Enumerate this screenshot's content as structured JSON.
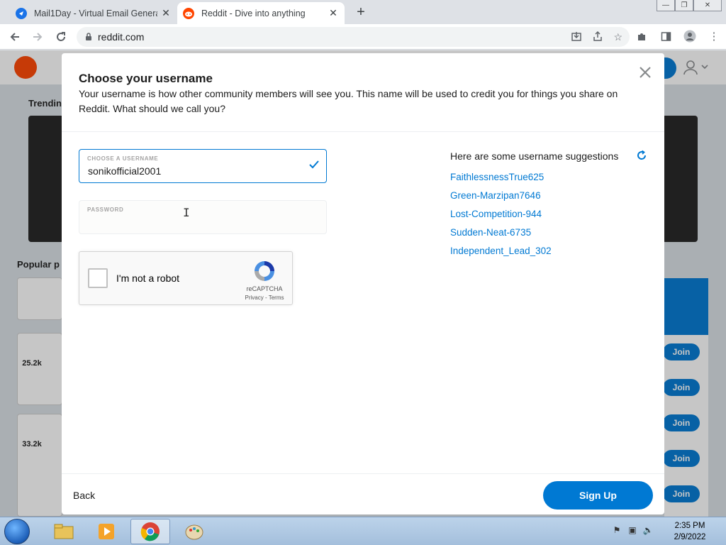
{
  "browser": {
    "tabs": [
      {
        "title": "Mail1Day - Virtual Email Generat",
        "active": false,
        "favicon": "mail1day-icon"
      },
      {
        "title": "Reddit - Dive into anything",
        "active": true,
        "favicon": "reddit-icon"
      }
    ],
    "url": "reddit.com"
  },
  "background_page": {
    "trending_heading": "Trendin",
    "popular_heading": "Popular p",
    "votes": [
      "25.2k",
      "33.2k"
    ],
    "join_labels": [
      "Join",
      "Join",
      "Join",
      "Join",
      "Join"
    ]
  },
  "modal": {
    "title": "Choose your username",
    "description": "Your username is how other community members will see you. This name will be used to credit you for things you share on Reddit. What should we call you?",
    "username_label": "CHOOSE A USERNAME",
    "username_value": "sonikofficial2001",
    "password_label": "PASSWORD",
    "password_value": "",
    "captcha": {
      "label": "I'm not a robot",
      "brand": "reCAPTCHA",
      "links": "Privacy - Terms"
    },
    "suggestions_title": "Here are some username suggestions",
    "suggestions": [
      "FaithlessnessTrue625",
      "Green-Marzipan7646",
      "Lost-Competition-944",
      "Sudden-Neat-6735",
      "Independent_Lead_302"
    ],
    "back_label": "Back",
    "signup_label": "Sign Up"
  },
  "taskbar": {
    "time": "2:35 PM",
    "date": "2/9/2022"
  },
  "colors": {
    "reddit_blue": "#0079d3",
    "reddit_orange": "#ff4500"
  }
}
